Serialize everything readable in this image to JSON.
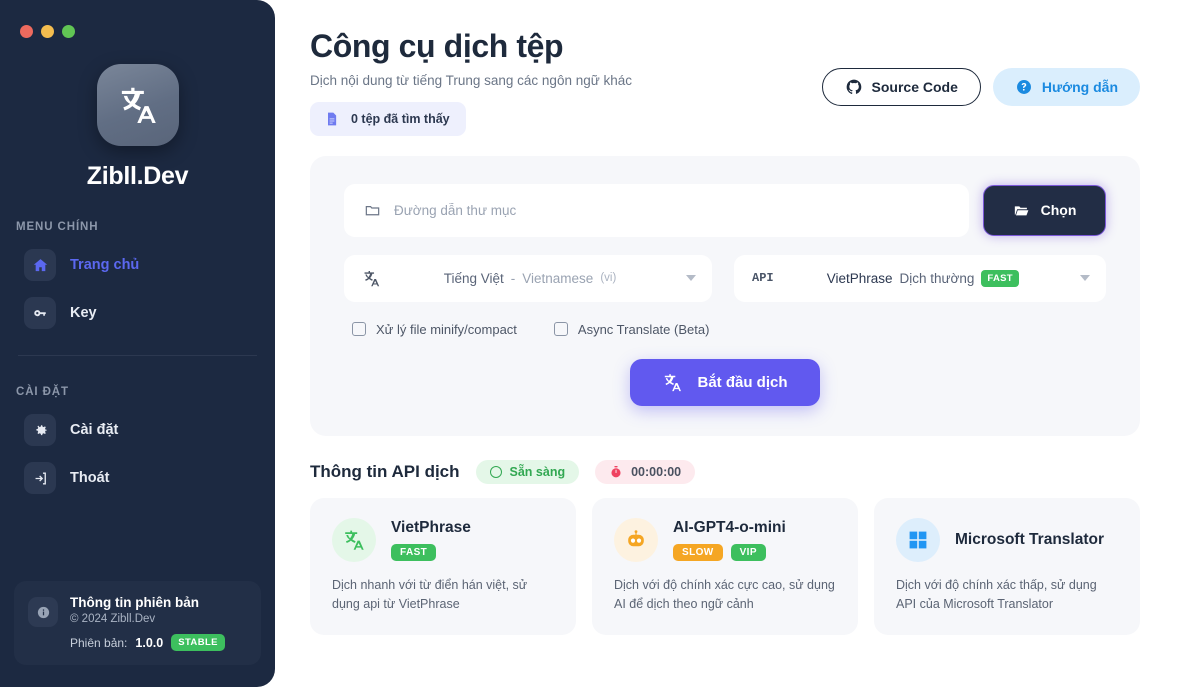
{
  "window": {
    "traffic_lights": [
      "close",
      "minimize",
      "maximize"
    ]
  },
  "sidebar": {
    "brand_name": "Zibll.Dev",
    "brand_icon": "translate-icon",
    "sections": [
      {
        "title": "MENU CHÍNH",
        "items": [
          {
            "label": "Trang chủ",
            "icon": "home-icon",
            "active": true
          },
          {
            "label": "Key",
            "icon": "key-icon",
            "active": false
          }
        ]
      },
      {
        "title": "CÀI ĐẶT",
        "items": [
          {
            "label": "Cài đặt",
            "icon": "gear-icon",
            "active": false
          },
          {
            "label": "Thoát",
            "icon": "exit-icon",
            "active": false
          }
        ]
      }
    ],
    "version": {
      "icon": "info-icon",
      "title": "Thông tin phiên bản",
      "copyright": "© 2024 Zibll.Dev",
      "version_label": "Phiên bản:",
      "version_number": "1.0.0",
      "badge": "STABLE",
      "badge_color": "#3dbf5e"
    }
  },
  "header": {
    "title": "Công cụ dịch tệp",
    "subtitle": "Dịch nội dung từ tiếng Trung sang các ngôn ngữ khác",
    "file_chip": {
      "icon": "document-icon",
      "text": "0 tệp đã tìm thấy"
    },
    "source_code_button": {
      "label": "Source Code",
      "icon": "github-icon"
    },
    "guide_button": {
      "label": "Hướng dẫn",
      "icon": "question-circle-icon",
      "color": "#1b8ae0"
    }
  },
  "panel": {
    "path_input": {
      "icon": "folder-icon",
      "placeholder": "Đường dẫn thư mục",
      "value": ""
    },
    "choose_button": {
      "label": "Chọn",
      "icon": "folder-open-icon"
    },
    "language_select": {
      "icon": "translate-icon",
      "primary": "Tiếng Việt",
      "separator": "-",
      "secondary": "Vietnamese",
      "code": "(vi)",
      "caret": "chevron-down-icon"
    },
    "api_select": {
      "label": "API",
      "primary": "VietPhrase",
      "secondary": "Dịch thường",
      "badge": "FAST",
      "badge_color": "#3dbf5e",
      "caret": "chevron-down-icon"
    },
    "checkboxes": [
      {
        "label": "Xử lý file minify/compact",
        "checked": false
      },
      {
        "label": "Async Translate (Beta)",
        "checked": false
      }
    ],
    "start_button": {
      "label": "Bắt đầu dịch",
      "icon": "translate-icon",
      "color": "#6159ef"
    }
  },
  "api_info": {
    "section_title": "Thông tin API dịch",
    "status_badge": {
      "label": "Sẵn sàng",
      "icon": "circle-icon",
      "color": "#32a852"
    },
    "timer_badge": {
      "label": "00:00:00",
      "icon": "stopwatch-icon",
      "color": "#ef4361"
    },
    "cards": [
      {
        "name": "VietPhrase",
        "icon": "translate-icon",
        "icon_bg": "#e4f7e8",
        "icon_color": "#3dbf5e",
        "tags": [
          {
            "label": "FAST",
            "type": "fast"
          }
        ],
        "description": "Dịch nhanh với từ điển hán việt, sử dụng api từ VietPhrase"
      },
      {
        "name": "AI-GPT4-o-mini",
        "icon": "robot-icon",
        "icon_bg": "#fdf2e0",
        "icon_color": "#f5a623",
        "tags": [
          {
            "label": "SLOW",
            "type": "slow"
          },
          {
            "label": "VIP",
            "type": "vip"
          }
        ],
        "description": "Dịch với độ chính xác cực cao, sử dụng AI để dịch theo ngữ cảnh"
      },
      {
        "name": "Microsoft Translator",
        "icon": "windows-icon",
        "icon_bg": "#ddeefc",
        "icon_color": "#2196f3",
        "tags": [],
        "description": "Dịch với độ chính xác thấp, sử dụng API của Microsoft Translator"
      }
    ]
  }
}
